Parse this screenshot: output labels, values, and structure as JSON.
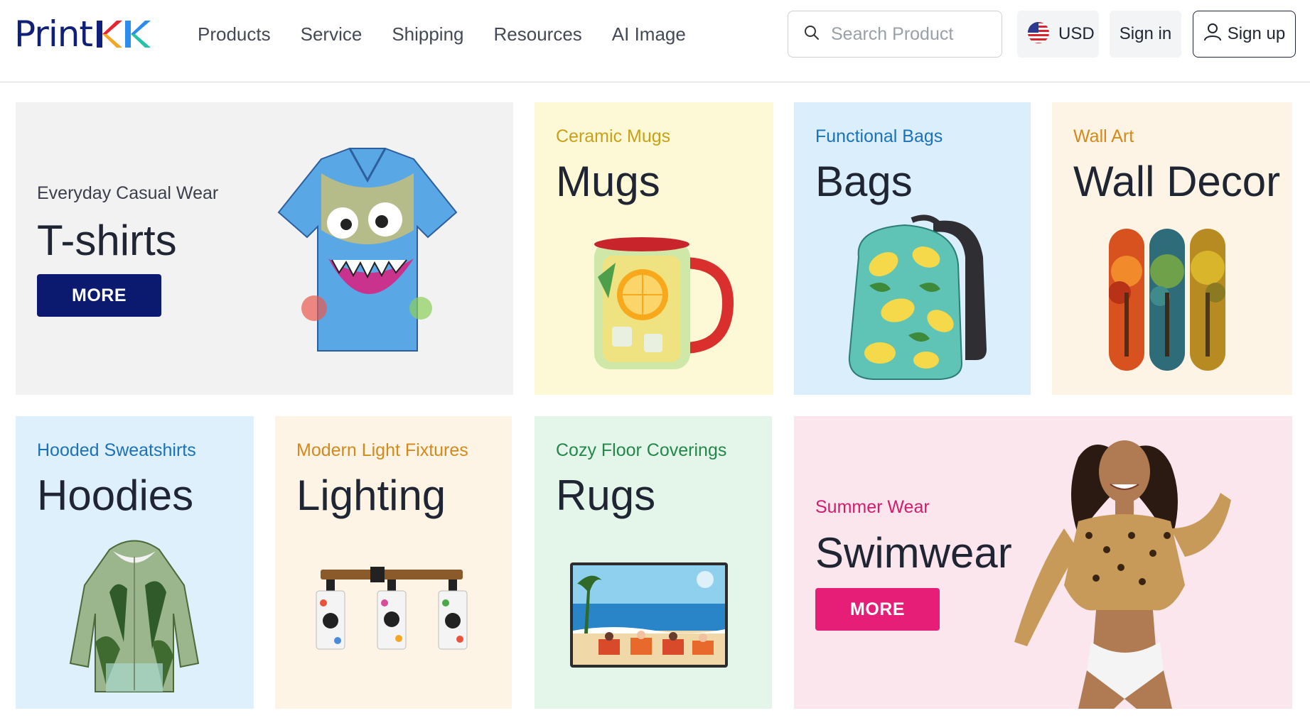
{
  "header": {
    "logo_print": "Print",
    "logo_kk": "KK",
    "nav": [
      "Products",
      "Service",
      "Shipping",
      "Resources",
      "AI Image"
    ],
    "search_placeholder": "Search Product",
    "currency": "USD",
    "signin": "Sign in",
    "signup": "Sign up"
  },
  "cards": {
    "tshirts": {
      "subtitle": "Everyday Casual Wear",
      "title": "T-shirts",
      "button": "MORE",
      "bg": "#f2f2f2",
      "accent": "#3b3f4a",
      "button_color": "#0b1a6e",
      "image": "hawaiian-shirt-image"
    },
    "mugs": {
      "subtitle": "Ceramic Mugs",
      "title": "Mugs",
      "bg": "#fdf9d6",
      "accent": "#c9a019",
      "image": "lemonade-mug-image"
    },
    "bags": {
      "subtitle": "Functional Bags",
      "title": "Bags",
      "bg": "#dbeefb",
      "accent": "#1b72b8",
      "image": "lemon-backpack-image"
    },
    "walldecor": {
      "subtitle": "Wall Art",
      "title": "Wall Decor",
      "bg": "#fdf4e6",
      "accent": "#d38a1c",
      "image": "tree-panels-image"
    },
    "hoodies": {
      "subtitle": "Hooded Sweatshirts",
      "title": "Hoodies",
      "bg": "#def0fb",
      "accent": "#1b72b8",
      "image": "palm-hoodie-image"
    },
    "lighting": {
      "subtitle": "Modern Light Fixtures",
      "title": "Lighting",
      "bg": "#fdf4e6",
      "accent": "#d38a1c",
      "image": "cat-light-fixture-image"
    },
    "rugs": {
      "subtitle": "Cozy Floor Coverings",
      "title": "Rugs",
      "bg": "#e4f6ea",
      "accent": "#23874a",
      "image": "beach-rug-image"
    },
    "swimwear": {
      "subtitle": "Summer Wear",
      "title": "Swimwear",
      "button": "MORE",
      "bg": "#fce6ee",
      "accent": "#d41c6c",
      "button_color": "#e61e78",
      "image": "model-swimwear-image"
    }
  }
}
